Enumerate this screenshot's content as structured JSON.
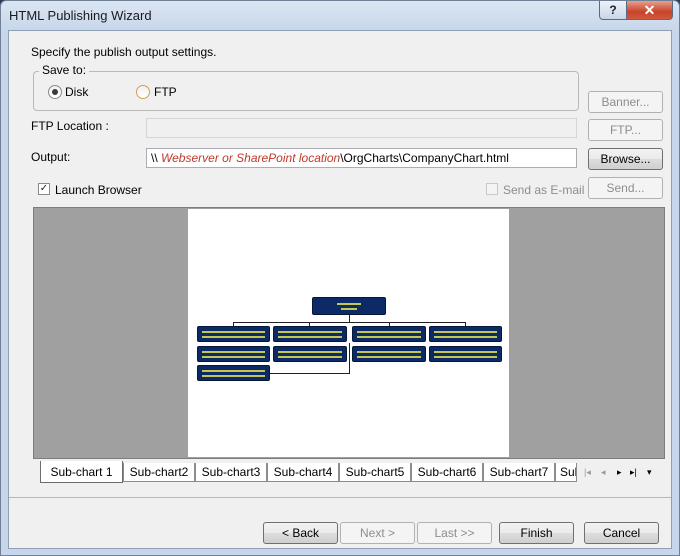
{
  "window": {
    "title": "HTML Publishing Wizard",
    "help_glyph": "?",
    "close_glyph": "✕"
  },
  "instruction": "Specify the publish output settings.",
  "save_to": {
    "label": "Save to:",
    "options": [
      {
        "label": "Disk",
        "selected": true
      },
      {
        "label": "FTP",
        "selected": false
      }
    ]
  },
  "ftp_location": {
    "label": "FTP Location :",
    "value": ""
  },
  "output": {
    "label": "Output:",
    "prefix": "\\\\ ",
    "placeholder_part": "Webserver or SharePoint location",
    "suffix": "\\OrgCharts\\CompanyChart.html",
    "placeholder_color": "#c0392b"
  },
  "launch_browser": {
    "label": "Launch Browser",
    "checked": true
  },
  "send_as_email": {
    "label": "Send as E-mail",
    "checked": false
  },
  "side_buttons": {
    "banner": "Banner...",
    "ftp": "FTP...",
    "browse": "Browse...",
    "send": "Send..."
  },
  "tabs": [
    "Sub-chart 1",
    "Sub-chart2",
    "Sub-chart3",
    "Sub-chart4",
    "Sub-chart5",
    "Sub-chart6",
    "Sub-chart7",
    "Sub"
  ],
  "tab_nav": {
    "first": "|◂",
    "prev": "◂",
    "next": "▸",
    "last": "▸|",
    "menu": "▾"
  },
  "footer_buttons": {
    "back": "< Back",
    "next": "Next >",
    "last": "Last >>",
    "finish": "Finish",
    "cancel": "Cancel"
  }
}
